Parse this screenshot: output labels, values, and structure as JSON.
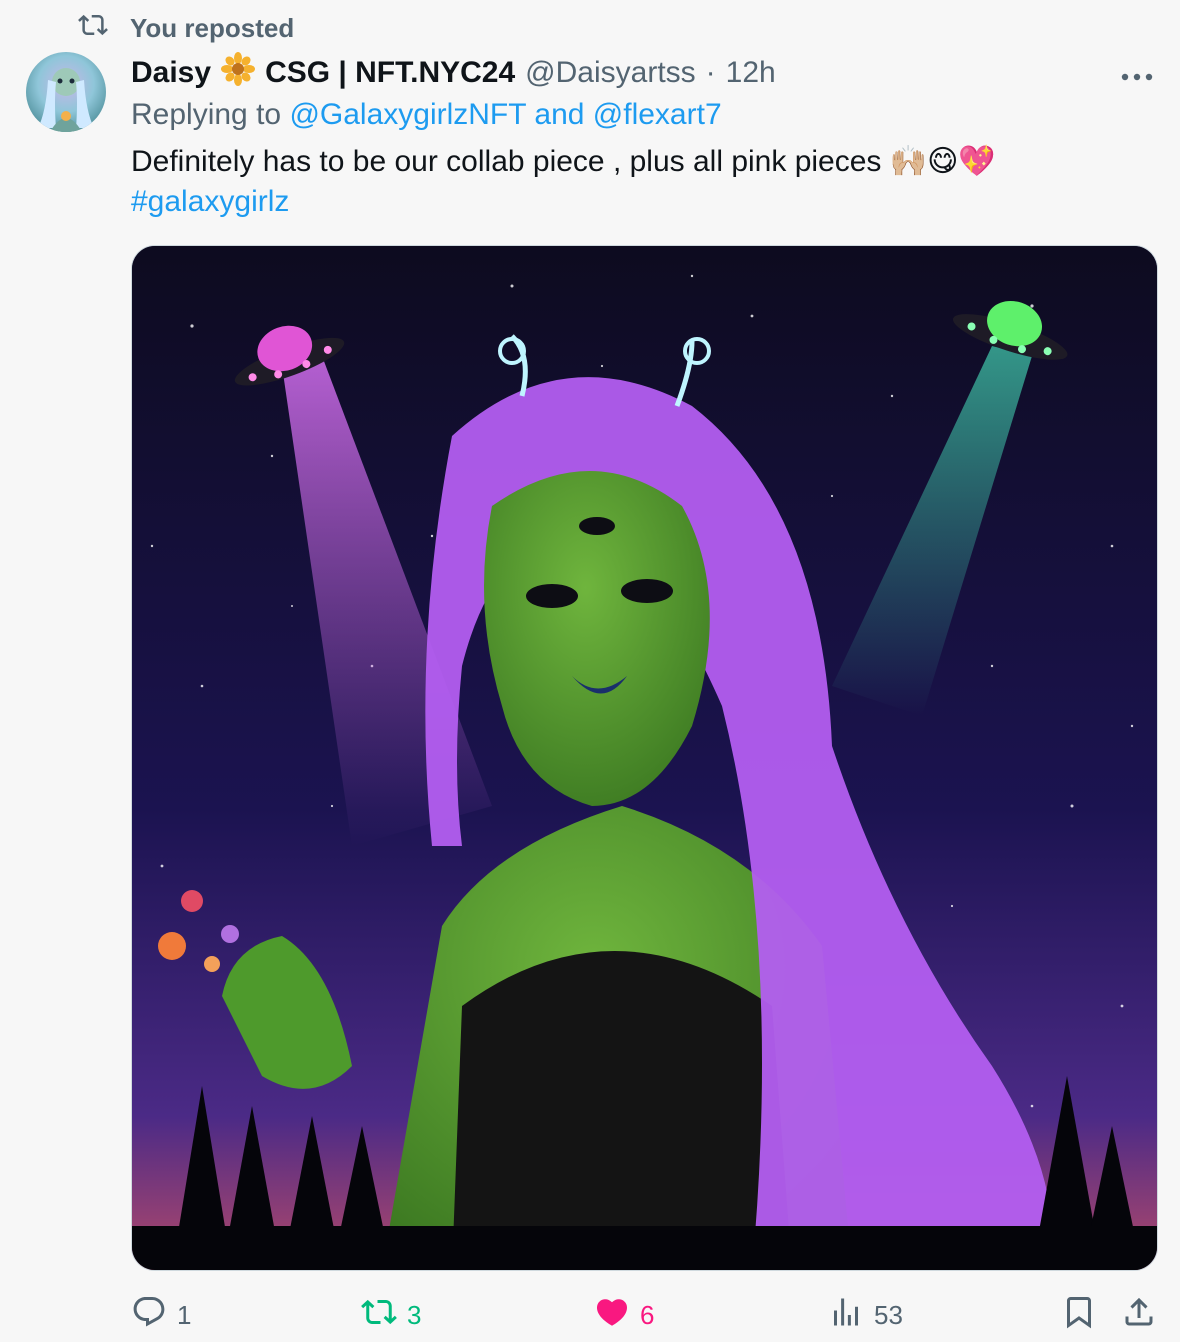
{
  "repost": {
    "label": "You reposted"
  },
  "tweet": {
    "display_name": "Daisy",
    "name_suffix": "CSG | NFT.NYC24",
    "handle": "@Daisyartss",
    "separator": "·",
    "time": "12h",
    "replying_prefix": "Replying to",
    "reply_mention_1": "@GalaxygirlzNFT",
    "reply_and": "and",
    "reply_mention_2": "@flexart7",
    "text": "Definitely has to be our collab piece , plus all pink pieces 🙌🏼😋💖",
    "hashtag": "#galaxygirlz"
  },
  "actions": {
    "replies": "1",
    "reposts": "3",
    "likes": "6",
    "views": "53"
  },
  "icons": {
    "repost": "repost-icon",
    "reply": "reply-icon",
    "like": "heart-icon",
    "views": "views-icon",
    "bookmark": "bookmark-icon",
    "share": "share-icon",
    "more": "more-icon",
    "badge": "flower-badge-icon"
  },
  "colors": {
    "muted": "#536471",
    "link": "#1d9bf0",
    "repost_active": "#00ba7c",
    "like_active": "#f91880"
  }
}
